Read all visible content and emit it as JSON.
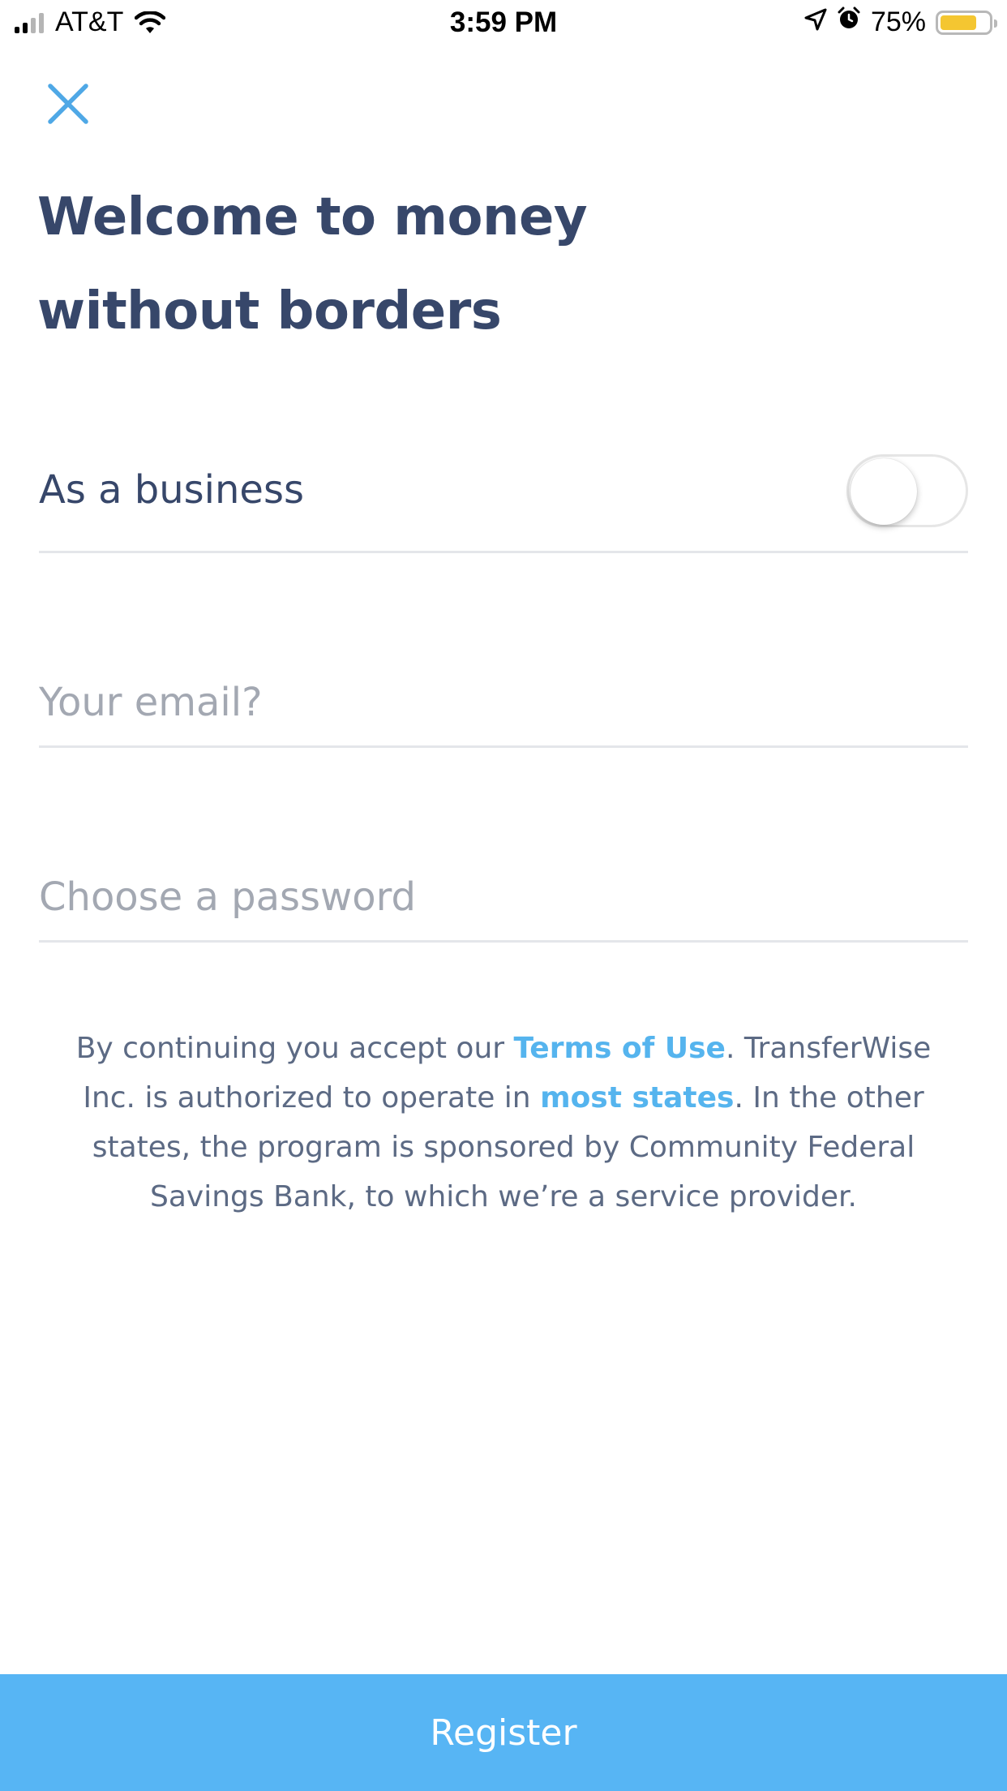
{
  "status_bar": {
    "carrier": "AT&T",
    "time": "3:59 PM",
    "battery_percent": "75%",
    "battery_level": 0.75,
    "icons": [
      "signal-icon",
      "wifi-icon",
      "location-arrow-icon",
      "alarm-icon",
      "battery-icon"
    ]
  },
  "header": {
    "close_icon": "close-icon",
    "title": "Welcome to money without borders"
  },
  "form": {
    "business_label": "As a business",
    "business_toggle_on": false,
    "email_placeholder": "Your email?",
    "email_value": "",
    "password_placeholder": "Choose a password",
    "password_value": ""
  },
  "legal": {
    "part1": "By continuing you accept our ",
    "terms_link": "Terms of Use",
    "part2": ". TransferWise Inc. is authorized to operate in ",
    "states_link": "most states",
    "part3": ". In the other states, the program is sponsored by Community Federal Savings Bank, to which we’re a service provider."
  },
  "footer": {
    "register_label": "Register"
  },
  "colors": {
    "accent": "#57b5f4",
    "link": "#55b4ee",
    "heading": "#37476a",
    "placeholder": "#a3a8b2",
    "battery": "#f4c631"
  }
}
